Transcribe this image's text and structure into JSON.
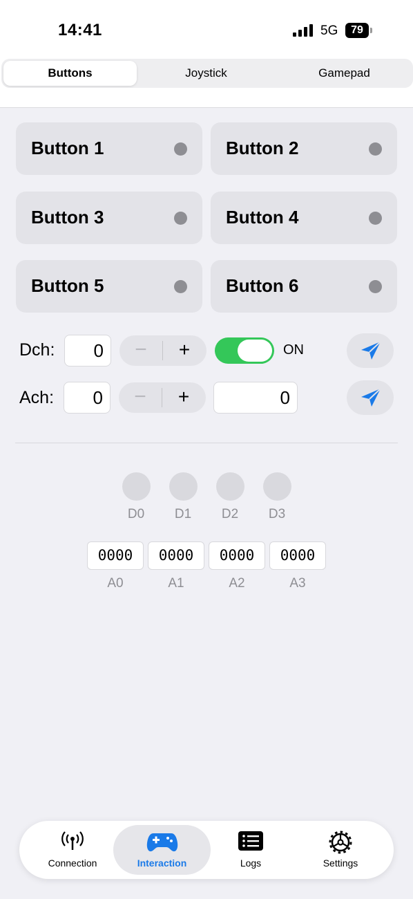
{
  "status": {
    "time": "14:41",
    "network": "5G",
    "battery": "79"
  },
  "segments": [
    {
      "label": "Buttons",
      "active": true
    },
    {
      "label": "Joystick",
      "active": false
    },
    {
      "label": "Gamepad",
      "active": false
    }
  ],
  "buttons": [
    "Button 1",
    "Button 2",
    "Button 3",
    "Button 4",
    "Button 5",
    "Button 6"
  ],
  "digital": {
    "label": "Dch:",
    "channel": "0",
    "minus": "−",
    "plus": "+",
    "toggle_on": true,
    "state_label": "ON"
  },
  "analog": {
    "label": "Ach:",
    "channel": "0",
    "minus": "−",
    "plus": "+",
    "value": "0"
  },
  "digital_indicators": [
    "D0",
    "D1",
    "D2",
    "D3"
  ],
  "analog_readouts": [
    {
      "label": "A0",
      "value": "0000"
    },
    {
      "label": "A1",
      "value": "0000"
    },
    {
      "label": "A2",
      "value": "0000"
    },
    {
      "label": "A3",
      "value": "0000"
    }
  ],
  "tabbar": [
    {
      "label": "Connection",
      "icon": "antenna-icon",
      "active": false
    },
    {
      "label": "Interaction",
      "icon": "gamecontroller-icon",
      "active": true
    },
    {
      "label": "Logs",
      "icon": "list-icon",
      "active": false
    },
    {
      "label": "Settings",
      "icon": "gear-icon",
      "active": false
    }
  ],
  "colors": {
    "accent": "#1a7ae8",
    "toggle_on": "#34c759",
    "card": "#e3e3e8",
    "indicator_off": "#8e8e93"
  }
}
